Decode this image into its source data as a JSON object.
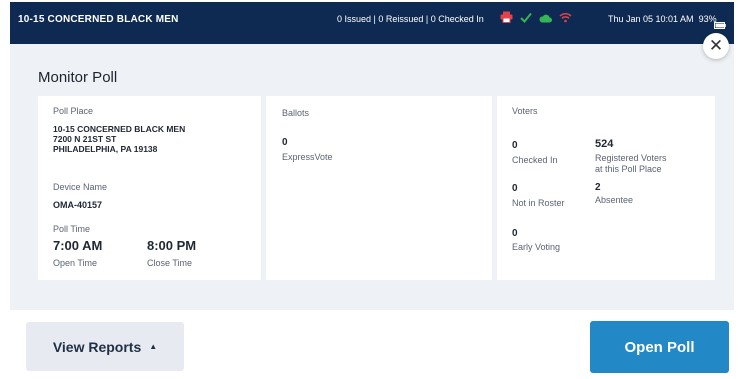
{
  "header": {
    "poll_place": "10-15 CONCERNED BLACK MEN",
    "counts": "0 Issued | 0 Reissued | 0 Checked In",
    "datetime": "Thu Jan 05  10:01 AM",
    "battery": "93%",
    "icons": [
      "printer-icon",
      "check-icon",
      "cloud-icon",
      "wifi-icon",
      "battery-icon"
    ],
    "colors": {
      "bar": "#0e2a52",
      "printer": "#e0434b",
      "check": "#34b556",
      "cloud": "#34b556",
      "wifi": "#e0434b"
    }
  },
  "modal": {
    "title": "Monitor Poll",
    "close_icon": "close-icon"
  },
  "poll_place": {
    "label": "Poll Place",
    "name": "10-15 CONCERNED BLACK MEN",
    "address_line1": "7200 N 21ST ST",
    "address_line2": "PHILADELPHIA, PA 19138",
    "device_label": "Device Name",
    "device_value": "OMA-40157",
    "time_label": "Poll Time",
    "open_time": "7:00 AM",
    "open_label": "Open Time",
    "close_time": "8:00 PM",
    "close_label": "Close Time"
  },
  "ballots": {
    "label": "Ballots",
    "count": "0",
    "count_label": "ExpressVote"
  },
  "voters": {
    "label": "Voters",
    "checked_in": "0",
    "checked_in_label": "Checked In",
    "registered": "524",
    "registered_label_1": "Registered Voters",
    "registered_label_2": "at this Poll Place",
    "not_in_roster": "0",
    "not_in_roster_label": "Not in Roster",
    "absentee": "2",
    "absentee_label": "Absentee",
    "early_voting": "0",
    "early_voting_label": "Early Voting"
  },
  "footer": {
    "view_reports_label": "View Reports",
    "open_poll_label": "Open Poll",
    "accent": "#2288c6"
  }
}
